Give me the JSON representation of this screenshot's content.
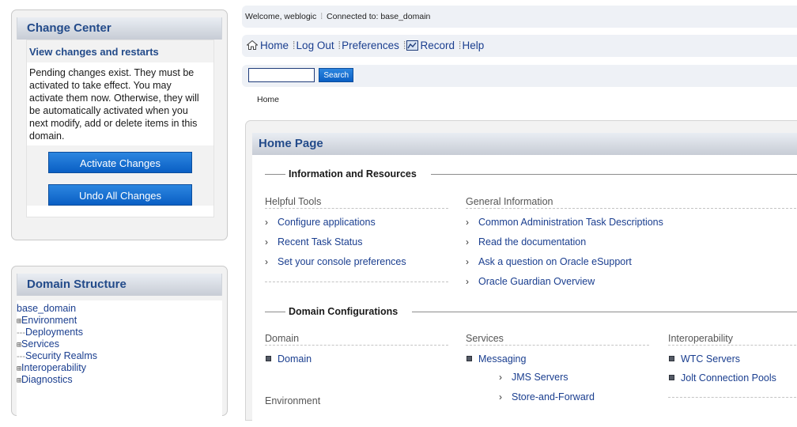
{
  "change_center": {
    "title": "Change Center",
    "subtitle": "View changes and restarts",
    "message": "Pending changes exist. They must be activated to take effect. You may activate them now. Otherwise, they will be automatically activated when you next modify, add or delete items in this domain.",
    "activate_label": "Activate Changes",
    "undo_label": "Undo All Changes"
  },
  "domain_structure": {
    "title": "Domain Structure",
    "root": "base_domain",
    "items": [
      {
        "label": "Environment",
        "expander": "⊞"
      },
      {
        "label": "Deployments",
        "expander": "---"
      },
      {
        "label": "Services",
        "expander": "⊞"
      },
      {
        "label": "Security Realms",
        "expander": "---"
      },
      {
        "label": "Interoperability",
        "expander": "⊞"
      },
      {
        "label": "Diagnostics",
        "expander": "⊞"
      }
    ]
  },
  "header": {
    "welcome": "Welcome, weblogic",
    "connected": "Connected to: base_domain",
    "nav": {
      "home": "Home",
      "logout": "Log Out",
      "preferences": "Preferences",
      "record": "Record",
      "help": "Help"
    },
    "search_label": "Search",
    "search_value": ""
  },
  "breadcrumb": "Home",
  "home": {
    "title": "Home Page",
    "info_section": "Information and Resources",
    "helpful_tools": {
      "heading": "Helpful Tools",
      "links": [
        "Configure applications",
        "Recent Task Status",
        "Set your console preferences"
      ]
    },
    "general_info": {
      "heading": "General Information",
      "links": [
        "Common Administration Task Descriptions",
        "Read the documentation",
        "Ask a question on Oracle eSupport",
        "Oracle Guardian Overview"
      ]
    },
    "domain_section": "Domain Configurations",
    "domain_col": {
      "heading": "Domain",
      "links": [
        "Domain"
      ]
    },
    "environment_heading": "Environment",
    "services_col": {
      "heading": "Services",
      "messaging": "Messaging",
      "sub_links": [
        "JMS Servers",
        "Store-and-Forward"
      ]
    },
    "interop_col": {
      "heading": "Interoperability",
      "links": [
        "WTC Servers",
        "Jolt Connection Pools"
      ]
    }
  },
  "colors": {
    "accent_blue": "#0a5fc4",
    "title_blue": "#234b8a",
    "link_blue": "#1a3e8f",
    "bar_bg": "#eef1f6"
  }
}
